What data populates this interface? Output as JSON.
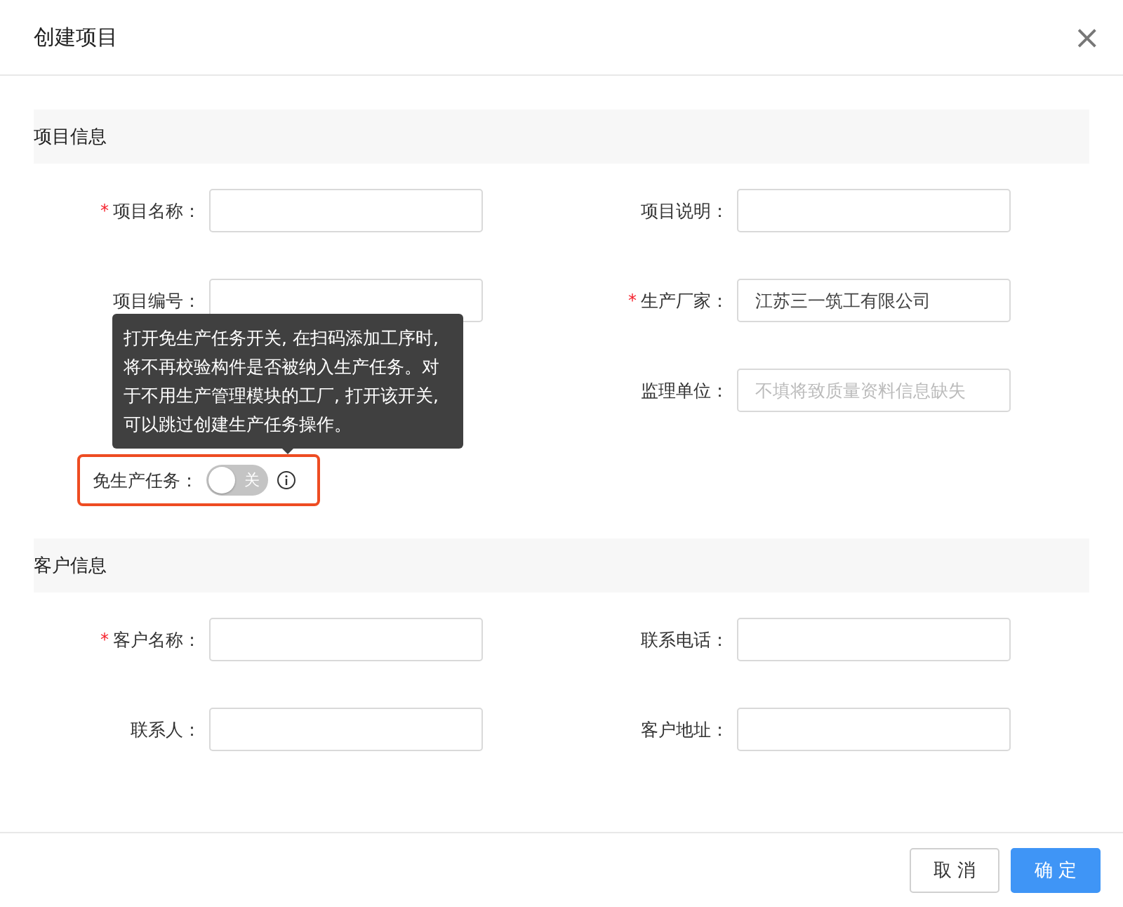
{
  "dialog": {
    "title": "创建项目",
    "close": "×"
  },
  "sections": [
    {
      "title": "项目信息",
      "fields": [
        {
          "kind": "input",
          "label": "项目名称：",
          "mark": "*"
        },
        {
          "kind": "input",
          "label": "项目说明："
        },
        {
          "kind": "input",
          "label": "项目编号："
        },
        {
          "kind": "input",
          "label": "生产厂家：",
          "mark": "*",
          "value": "江苏三一筑工有限公司"
        },
        {
          "kind": "blank"
        },
        {
          "kind": "input",
          "label": "监理单位：",
          "placeholder": "不填将致质量资料信息缺失"
        },
        {
          "kind": "switch",
          "label": "免生产任务：",
          "on": false,
          "text": "关",
          "highlighted": true,
          "info": true
        }
      ]
    },
    {
      "title": "客户信息",
      "fields": [
        {
          "kind": "input",
          "label": "客户名称：",
          "mark": "*"
        },
        {
          "kind": "input",
          "label": "联系电话："
        },
        {
          "kind": "input",
          "label": "联系人："
        },
        {
          "kind": "input",
          "label": "客户地址："
        }
      ]
    }
  ],
  "tooltip": {
    "text": "打开免生产任务开关, 在扫码添加工序时, 将不再校验构件是否被纳入生产任务。对于不用生产管理模块的工厂, 打开该开关, 可以跳过创建生产任务操作。"
  },
  "buttons": [
    {
      "label": "取 消",
      "kind": "secondary"
    },
    {
      "label": "确 定",
      "kind": "primary"
    }
  ]
}
